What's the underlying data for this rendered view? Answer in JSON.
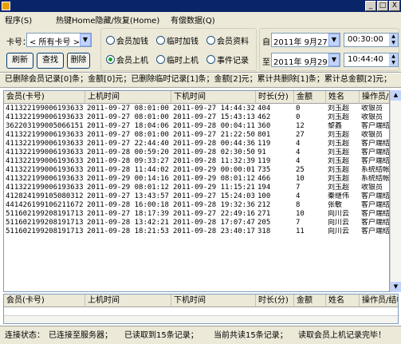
{
  "window": {
    "title": "",
    "minimize": "_",
    "maximize": "□",
    "close": "X"
  },
  "menu": [
    {
      "label": "程序(S)"
    },
    {
      "label": "热键Home隐藏/恢复(Home)"
    },
    {
      "label": "有偿数据(Q)"
    }
  ],
  "toolbar": {
    "card_label": "卡号：",
    "card_select": "< 所有卡号 >",
    "refresh": "刷新",
    "search": "查找",
    "delete": "删除",
    "radios": [
      {
        "label": "会员加钱",
        "checked": false
      },
      {
        "label": "临时加钱",
        "checked": false
      },
      {
        "label": "会员资料",
        "checked": false
      },
      {
        "label": "会员上机",
        "checked": true
      },
      {
        "label": "临时上机",
        "checked": false
      },
      {
        "label": "事件记录",
        "checked": false
      }
    ],
    "from_label": "自",
    "to_label": "至",
    "from_date": "2011年 9月27日",
    "from_time": "00:30:00",
    "to_date": "2011年 9月29日",
    "to_time": "10:44:40"
  },
  "summary": "已删除会员记录[0]条；金额[0]元；已删除临时记录[1]条；金额[2]元；累计共删除[1]条；累计总金额[2]元；",
  "table": {
    "headers": [
      "会员(卡号)",
      "上机时间",
      "下机时间",
      "时长(分)",
      "金额",
      "姓名",
      "操作员/结帐"
    ],
    "rows": [
      [
        "411322199006193633",
        "2011-09-27 08:01:00",
        "2011-09-27 14:44:32",
        "404",
        "0",
        "刘玉超",
        "收银员"
      ],
      [
        "411322199006193633",
        "2011-09-27 08:01:00",
        "2011-09-27 15:43:13",
        "462",
        "0",
        "刘玉超",
        "收银员"
      ],
      [
        "362203199005066151",
        "2011-09-27 18:04:06",
        "2011-09-28 00:04:11",
        "360",
        "12",
        "黎鑫",
        "客户端结帐"
      ],
      [
        "411322199006193633",
        "2011-09-27 08:01:00",
        "2011-09-27 21:22:50",
        "801",
        "27",
        "刘玉超",
        "收银员"
      ],
      [
        "411322199006193633",
        "2011-09-27 22:44:40",
        "2011-09-28 00:44:36",
        "119",
        "4",
        "刘玉超",
        "客户端结帐"
      ],
      [
        "411322199006193633",
        "2011-09-28 00:59:20",
        "2011-09-28 02:30:50",
        "91",
        "4",
        "刘玉超",
        "客户端结帐"
      ],
      [
        "411322199006193633",
        "2011-09-28 09:33:27",
        "2011-09-28 11:32:39",
        "119",
        "4",
        "刘玉超",
        "客户端结帐"
      ],
      [
        "411322199006193633",
        "2011-09-28 11:44:02",
        "2011-09-29 00:00:01",
        "735",
        "25",
        "刘玉超",
        "系统结帐(…"
      ],
      [
        "411322199006193633",
        "2011-09-29 00:14:16",
        "2011-09-29 08:01:12",
        "466",
        "10",
        "刘玉超",
        "系统结帐X"
      ],
      [
        "411322199006193633",
        "2011-09-29 08:01:12",
        "2011-09-29 11:15:21",
        "194",
        "7",
        "刘玉超",
        "收银员"
      ],
      [
        "412824199105080312",
        "2011-09-27 13:43:57",
        "2011-09-27 15:24:03",
        "100",
        "4",
        "秦继伟",
        "客户端结帐"
      ],
      [
        "441426199106211672",
        "2011-09-28 16:00:18",
        "2011-09-28 19:32:36",
        "212",
        "8",
        "张敏",
        "客户端结帐"
      ],
      [
        "511602199208191713",
        "2011-09-27 18:17:39",
        "2011-09-27 22:49:16",
        "271",
        "10",
        "向川云",
        "客户端结帐"
      ],
      [
        "511602199208191713",
        "2011-09-28 13:42:21",
        "2011-09-28 17:07:47",
        "205",
        "7",
        "向川云",
        "客户端结帐"
      ],
      [
        "511602199208191713",
        "2011-09-28 18:21:53",
        "2011-09-28 23:40:17",
        "318",
        "11",
        "向川云",
        "客户端结帐"
      ]
    ]
  },
  "table2": {
    "headers": [
      "会员(卡号)",
      "上机时间",
      "下机时间",
      "时长(分)",
      "金额",
      "姓名",
      "操作员/结帐"
    ]
  },
  "status": {
    "connect_label": "连接状态：",
    "connected": "已连接至服务器；",
    "read": "已读取到15条记录；",
    "total": "当前共读15条记录；",
    "done": "读取会员上机记录完毕！"
  },
  "colors": {
    "titlebar": "#0a246a",
    "face": "#ece9d8",
    "header": "#ece9d8"
  }
}
